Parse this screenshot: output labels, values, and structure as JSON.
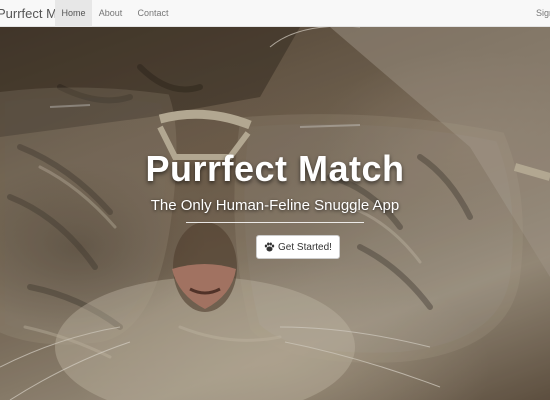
{
  "navbar": {
    "brand": "Purrfect Match",
    "links": [
      {
        "label": "Home",
        "active": true
      },
      {
        "label": "About",
        "active": false
      },
      {
        "label": "Contact",
        "active": false
      }
    ],
    "right_link": "Sign"
  },
  "hero": {
    "title": "Purrfect Match",
    "subtitle": "The Only Human-Feline Snuggle App",
    "cta_label": "Get Started!",
    "cta_icon": "paw-icon",
    "background_image": "cat-wearing-glasses-photo"
  },
  "colors": {
    "navbar_bg": "#f8f8f8",
    "active_tab_bg": "#e7e7e7",
    "hero_text": "#ffffff"
  }
}
